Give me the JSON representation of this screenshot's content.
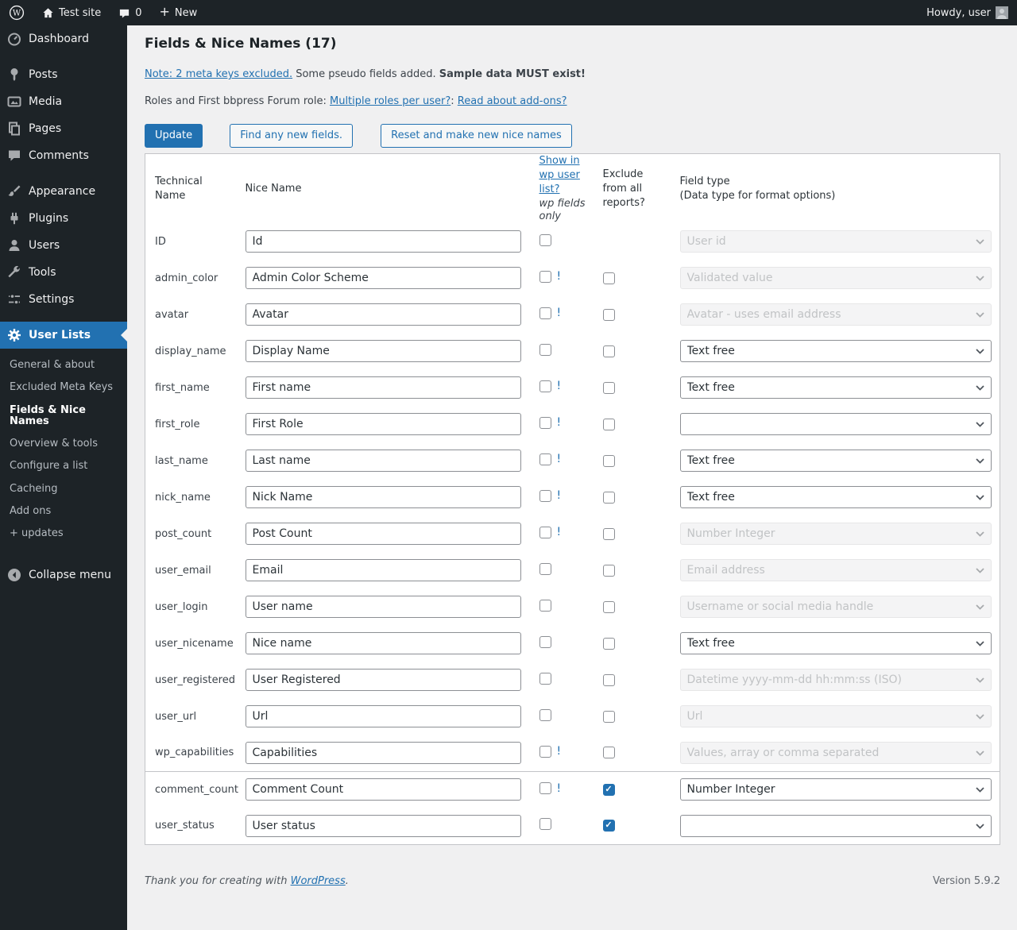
{
  "admin_bar": {
    "site_name": "Test site",
    "comment_count": "0",
    "new_label": "New",
    "howdy_text": "Howdy, user"
  },
  "sidebar": {
    "menu": [
      {
        "label": "Dashboard",
        "icon": "dashboard-icon"
      },
      {
        "label": "Posts",
        "icon": "pin-icon"
      },
      {
        "label": "Media",
        "icon": "media-icon"
      },
      {
        "label": "Pages",
        "icon": "pages-icon"
      },
      {
        "label": "Comments",
        "icon": "comment-bubble-icon"
      },
      {
        "label": "Appearance",
        "icon": "brush-icon"
      },
      {
        "label": "Plugins",
        "icon": "plugin-icon"
      },
      {
        "label": "Users",
        "icon": "person-icon"
      },
      {
        "label": "Tools",
        "icon": "wrench-icon"
      },
      {
        "label": "Settings",
        "icon": "sliders-icon"
      },
      {
        "label": "User Lists",
        "icon": "gear-icon"
      }
    ],
    "submenu": [
      {
        "label": "General & about",
        "current": false
      },
      {
        "label": "Excluded Meta Keys",
        "current": false
      },
      {
        "label": "Fields & Nice Names",
        "current": true
      },
      {
        "label": "Overview & tools",
        "current": false
      },
      {
        "label": "Configure a list",
        "current": false
      },
      {
        "label": "Cacheing",
        "current": false
      },
      {
        "label": "Add ons",
        "current": false
      },
      {
        "label": "+ updates",
        "current": false
      }
    ],
    "collapse_label": "Collapse menu"
  },
  "main": {
    "title": "Fields & Nice Names (17)",
    "note": {
      "link": "Note: 2 meta keys excluded.",
      "text": "Some pseudo fields added.",
      "bold": "Sample data MUST exist!"
    },
    "roles": {
      "prefix": "Roles and First bbpress Forum role:",
      "link1": "Multiple roles per user?",
      "separator": ":",
      "link2": "Read about add-ons?"
    },
    "buttons": {
      "update": "Update",
      "find_new": "Find any new fields.",
      "reset": "Reset and make new nice names"
    },
    "table": {
      "headers": {
        "technical_name": "Technical Name",
        "nice_name": "Nice Name",
        "show_link": "Show in wp user list?",
        "show_note": "wp fields only",
        "exclude": "Exclude from all reports?",
        "field_type_line1": "Field type",
        "field_type_line2": "(Data type for format options)"
      },
      "rows": [
        {
          "technical_name": "ID",
          "nice_name": "Id",
          "show_checked": false,
          "show_flag": "",
          "has_exclude": false,
          "exclude_checked": false,
          "field_type": "User id",
          "field_type_disabled": true,
          "section_start": false
        },
        {
          "technical_name": "admin_color",
          "nice_name": "Admin Color Scheme",
          "show_checked": false,
          "show_flag": "!",
          "has_exclude": true,
          "exclude_checked": false,
          "field_type": "Validated value",
          "field_type_disabled": true,
          "section_start": false
        },
        {
          "technical_name": "avatar",
          "nice_name": "Avatar",
          "show_checked": false,
          "show_flag": "!",
          "has_exclude": true,
          "exclude_checked": false,
          "field_type": "Avatar - uses email address",
          "field_type_disabled": true,
          "section_start": false
        },
        {
          "technical_name": "display_name",
          "nice_name": "Display Name",
          "show_checked": false,
          "show_flag": "",
          "has_exclude": true,
          "exclude_checked": false,
          "field_type": "Text free",
          "field_type_disabled": false,
          "section_start": false
        },
        {
          "technical_name": "first_name",
          "nice_name": "First name",
          "show_checked": false,
          "show_flag": "!",
          "has_exclude": true,
          "exclude_checked": false,
          "field_type": "Text free",
          "field_type_disabled": false,
          "section_start": false
        },
        {
          "technical_name": "first_role",
          "nice_name": "First Role",
          "show_checked": false,
          "show_flag": "!",
          "has_exclude": true,
          "exclude_checked": false,
          "field_type": "",
          "field_type_disabled": false,
          "section_start": false
        },
        {
          "technical_name": "last_name",
          "nice_name": "Last name",
          "show_checked": false,
          "show_flag": "!",
          "has_exclude": true,
          "exclude_checked": false,
          "field_type": "Text free",
          "field_type_disabled": false,
          "section_start": false
        },
        {
          "technical_name": "nick_name",
          "nice_name": "Nick Name",
          "show_checked": false,
          "show_flag": "!",
          "has_exclude": true,
          "exclude_checked": false,
          "field_type": "Text free",
          "field_type_disabled": false,
          "section_start": false
        },
        {
          "technical_name": "post_count",
          "nice_name": "Post Count",
          "show_checked": false,
          "show_flag": "!",
          "has_exclude": true,
          "exclude_checked": false,
          "field_type": "Number Integer",
          "field_type_disabled": true,
          "section_start": false
        },
        {
          "technical_name": "user_email",
          "nice_name": "Email",
          "show_checked": false,
          "show_flag": "",
          "has_exclude": true,
          "exclude_checked": false,
          "field_type": "Email address",
          "field_type_disabled": true,
          "section_start": false
        },
        {
          "technical_name": "user_login",
          "nice_name": "User name",
          "show_checked": false,
          "show_flag": "",
          "has_exclude": true,
          "exclude_checked": false,
          "field_type": "Username or social media handle",
          "field_type_disabled": true,
          "section_start": false
        },
        {
          "technical_name": "user_nicename",
          "nice_name": "Nice name",
          "show_checked": false,
          "show_flag": "",
          "has_exclude": true,
          "exclude_checked": false,
          "field_type": "Text free",
          "field_type_disabled": false,
          "section_start": false
        },
        {
          "technical_name": "user_registered",
          "nice_name": "User Registered",
          "show_checked": false,
          "show_flag": "",
          "has_exclude": true,
          "exclude_checked": false,
          "field_type": "Datetime yyyy-mm-dd hh:mm:ss (ISO)",
          "field_type_disabled": true,
          "section_start": false
        },
        {
          "technical_name": "user_url",
          "nice_name": "Url",
          "show_checked": false,
          "show_flag": "",
          "has_exclude": true,
          "exclude_checked": false,
          "field_type": "Url",
          "field_type_disabled": true,
          "section_start": false
        },
        {
          "technical_name": "wp_capabilities",
          "nice_name": "Capabilities",
          "show_checked": false,
          "show_flag": "!",
          "has_exclude": true,
          "exclude_checked": false,
          "field_type": "Values, array or comma separated",
          "field_type_disabled": true,
          "section_start": false
        },
        {
          "technical_name": "comment_count",
          "nice_name": "Comment Count",
          "show_checked": false,
          "show_flag": "!",
          "has_exclude": true,
          "exclude_checked": true,
          "field_type": "Number Integer",
          "field_type_disabled": false,
          "section_start": true
        },
        {
          "technical_name": "user_status",
          "nice_name": "User status",
          "show_checked": false,
          "show_flag": "",
          "has_exclude": true,
          "exclude_checked": true,
          "field_type": "",
          "field_type_disabled": false,
          "section_start": false
        }
      ]
    }
  },
  "footer": {
    "thanks_prefix": "Thank you for creating with",
    "wordpress_link": "WordPress",
    "suffix": ".",
    "version": "Version 5.9.2"
  },
  "colors": {
    "accent": "#2271b1",
    "admin_bar_bg": "#1d2327",
    "content_bg": "#f0f0f1",
    "table_border": "#c3c4c7"
  }
}
